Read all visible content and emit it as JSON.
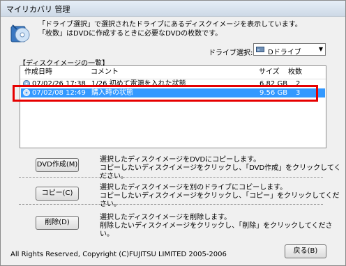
{
  "window": {
    "title": "マイリカバリ 管理"
  },
  "description": {
    "line1": "「ドライブ選択」で選択されたドライブにあるディスクイメージを表示しています。",
    "line2": "「枚数」はDVDに作成するときに必要なDVDの枚数です。"
  },
  "drive": {
    "label": "ドライブ選択:",
    "selected": "Dドライブ",
    "icon": "drive-icon"
  },
  "list": {
    "title": "【ディスクイメージの一覧】",
    "columns": {
      "date": "作成日時",
      "comment": "コメント",
      "size": "サイズ",
      "count": "枚数"
    },
    "rows": [
      {
        "date": "07/02/26 17:38",
        "comment": "1/26 初めて電源を入れた状態",
        "size": "6.82 GB",
        "count": "2"
      },
      {
        "date": "07/02/08 12:49",
        "comment": "購入時の状態",
        "size": "9.56 GB",
        "count": "3"
      }
    ]
  },
  "actions": {
    "dvd": {
      "label": "DVD作成(M)",
      "line1": "選択したディスクイメージをDVDにコピーします。",
      "line2": "コピーしたいディスクイメージをクリックし、「DVD作成」をクリックしてください。"
    },
    "copy": {
      "label": "コピー(C)",
      "line1": "選択したディスクイメージを別のドライブにコピーします。",
      "line2": "コピーしたいディスクイメージをクリックし、「コピー」をクリックしてください。"
    },
    "delete": {
      "label": "削除(D)",
      "line1": "選択したディスクイメージを削除します。",
      "line2": "削除したいディスクイメージをクリックし、「削除」をクリックしてください。"
    }
  },
  "footer": {
    "copyright": "All Rights Reserved, Copyright (C)FUJITSU LIMITED 2005-2006",
    "back_label": "戻る(B)"
  },
  "colors": {
    "selection": "#3399ff",
    "highlight_border": "#e60000"
  }
}
